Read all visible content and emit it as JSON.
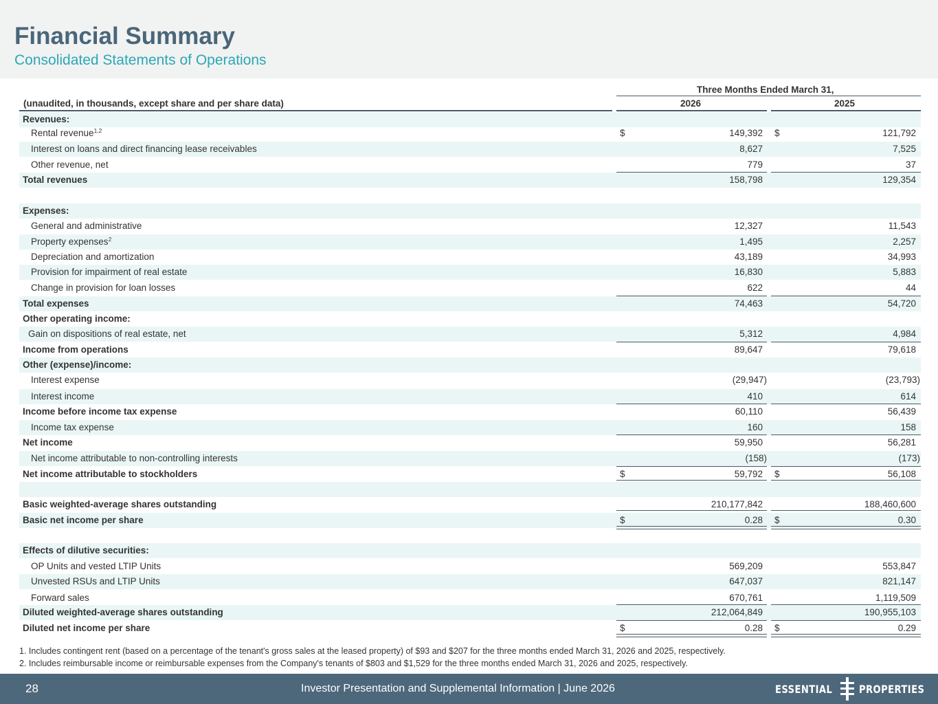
{
  "header": {
    "title": "Financial Summary",
    "subtitle": "Consolidated Statements of Operations"
  },
  "table": {
    "period_header": "Three Months Ended March 31,",
    "unit_note": "(unaudited, in thousands, except share and per share data)",
    "year_1": "2026",
    "year_2": "2025",
    "rows": [
      {
        "label": "Revenues:",
        "v26": "",
        "v25": ""
      },
      {
        "label": "Rental revenue",
        "sup": "1,2",
        "cur": "$",
        "v26": "149,392",
        "v25": "121,792"
      },
      {
        "label": "Interest on loans and direct financing lease receivables",
        "v26": "8,627",
        "v25": "7,525"
      },
      {
        "label": "Other revenue, net",
        "v26": "779",
        "v25": "37"
      },
      {
        "label": "Total revenues",
        "v26": "158,798",
        "v25": "129,354"
      },
      {
        "label": "",
        "v26": "",
        "v25": ""
      },
      {
        "label": "Expenses:",
        "v26": "",
        "v25": ""
      },
      {
        "label": "General and administrative",
        "v26": "12,327",
        "v25": "11,543"
      },
      {
        "label": "Property expenses",
        "sup": "2",
        "v26": "1,495",
        "v25": "2,257"
      },
      {
        "label": "Depreciation and amortization",
        "v26": "43,189",
        "v25": "34,993"
      },
      {
        "label": "Provision for impairment of real estate",
        "v26": "16,830",
        "v25": "5,883"
      },
      {
        "label": "Change in provision for loan losses",
        "v26": "622",
        "v25": "44"
      },
      {
        "label": "Total expenses",
        "v26": "74,463",
        "v25": "54,720"
      },
      {
        "label": "Other operating income:",
        "v26": "",
        "v25": ""
      },
      {
        "label": "Gain on dispositions of real estate, net",
        "v26": "5,312",
        "v25": "4,984"
      },
      {
        "label": "Income from operations",
        "v26": "89,647",
        "v25": "79,618"
      },
      {
        "label": "Other (expense)/income:",
        "v26": "",
        "v25": ""
      },
      {
        "label": "Interest expense",
        "v26": "(29,947)",
        "v25": "(23,793)"
      },
      {
        "label": "Interest income",
        "v26": "410",
        "v25": "614"
      },
      {
        "label": "Income before income tax expense",
        "v26": "60,110",
        "v25": "56,439"
      },
      {
        "label": "Income tax expense",
        "v26": "160",
        "v25": "158"
      },
      {
        "label": "Net income",
        "v26": "59,950",
        "v25": "56,281"
      },
      {
        "label": "Net income attributable to non-controlling interests",
        "v26": "(158)",
        "v25": "(173)"
      },
      {
        "label": "Net income attributable to stockholders",
        "cur": "$",
        "v26": "59,792",
        "v25": "56,108"
      },
      {
        "label": "",
        "v26": "",
        "v25": ""
      },
      {
        "label": "Basic weighted-average shares outstanding",
        "v26": "210,177,842",
        "v25": "188,460,600"
      },
      {
        "label": "Basic net income per share",
        "cur": "$",
        "v26": "0.28",
        "v25": "0.30"
      },
      {
        "label": "",
        "v26": "",
        "v25": ""
      },
      {
        "label": "Effects of dilutive securities:",
        "v26": "",
        "v25": ""
      },
      {
        "label": "OP Units and vested LTIP Units",
        "v26": "569,209",
        "v25": "553,847"
      },
      {
        "label": "Unvested RSUs and LTIP Units",
        "v26": "647,037",
        "v25": "821,147"
      },
      {
        "label": "Forward sales",
        "v26": "670,761",
        "v25": "1,119,509"
      },
      {
        "label": "Diluted weighted-average shares outstanding",
        "v26": "212,064,849",
        "v25": "190,955,103"
      },
      {
        "label": "Diluted net income per share",
        "cur": "$",
        "v26": "0.28",
        "v25": "0.29"
      }
    ]
  },
  "footnotes": [
    "1. Includes contingent rent (based on a percentage of the tenant's gross sales at the leased property) of $93 and $207 for the three months ended March 31, 2026 and 2025, respectively.",
    "2. Includes reimbursable income or reimbursable expenses from the Company's tenants of $803 and $1,529 for the three months ended March 31, 2026 and 2025, respectively."
  ],
  "footer": {
    "page_number": "28",
    "text": "Investor Presentation and Supplemental Information |  June 2026",
    "logo_left": "ESSENTIAL",
    "logo_right": "PROPERTIES"
  }
}
